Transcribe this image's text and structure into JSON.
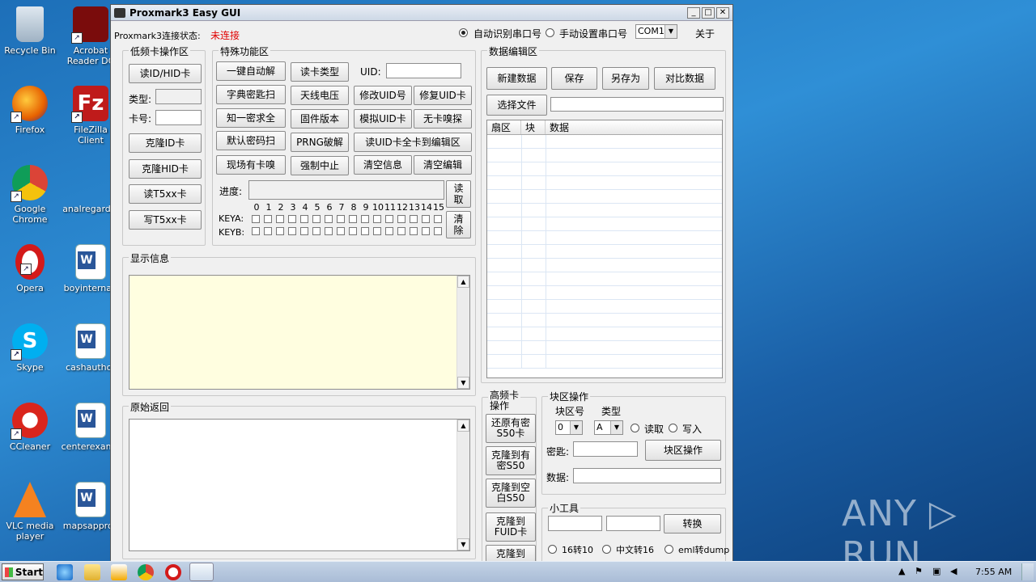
{
  "desktop": {
    "icons": [
      {
        "label": "Recycle Bin",
        "icon": "recycle-bin-icon"
      },
      {
        "label": "Acrobat Reader DC",
        "icon": "acrobat-icon"
      },
      {
        "label": "Firefox",
        "icon": "firefox-icon"
      },
      {
        "label": "FileZilla Client",
        "icon": "filezilla-icon"
      },
      {
        "label": "Google Chrome",
        "icon": "chrome-icon"
      },
      {
        "label": "analregardin",
        "icon": "file-icon"
      },
      {
        "label": "Opera",
        "icon": "opera-icon"
      },
      {
        "label": "boyinternati",
        "icon": "word-doc-icon"
      },
      {
        "label": "Skype",
        "icon": "skype-icon"
      },
      {
        "label": "cashauthor",
        "icon": "word-doc-icon"
      },
      {
        "label": "CCleaner",
        "icon": "ccleaner-icon"
      },
      {
        "label": "centerexamp",
        "icon": "word-doc-icon"
      },
      {
        "label": "VLC media player",
        "icon": "vlc-icon"
      },
      {
        "label": "mapsapprov",
        "icon": "word-doc-icon"
      }
    ],
    "watermark": "ANY ▷ RUN"
  },
  "window": {
    "title": "Proxmark3 Easy GUI",
    "controls": {
      "minimize": "_",
      "maximize": "□",
      "close": "✕"
    },
    "status_label": "Proxmark3连接状态:",
    "status_value": "未连接",
    "radio_auto": "自动识别串口号",
    "radio_manual": "手动设置串口号",
    "com_port": "COM1",
    "about": "关于",
    "low_freq": {
      "title": "低频卡操作区",
      "read_id_hid": "读ID/HID卡",
      "type_label": "类型:",
      "card_no_label": "卡号:",
      "clone_id": "克隆ID卡",
      "clone_hid": "克隆HID卡",
      "read_t5": "读T5xx卡",
      "write_t5": "写T5xx卡"
    },
    "special": {
      "title": "特殊功能区",
      "buttons": {
        "one_click": "一键自动解",
        "read_type": "读卡类型",
        "uid_label": "UID:",
        "dict_scan": "字典密匙扫",
        "antenna": "天线电压",
        "modify_uid": "修改UID号",
        "fix_uid": "修复UID卡",
        "know_one": "知一密求全",
        "firmware": "固件版本",
        "sim_uid": "模拟UID卡",
        "no_card": "无卡嗅探",
        "default_scan": "默认密码扫",
        "prng": "PRNG破解",
        "read_uid_full": "读UID卡全卡到编辑区",
        "sniff": "现场有卡嗅",
        "force_stop": "强制中止",
        "clear_info": "清空信息",
        "clear_edit": "清空编辑"
      },
      "progress_label": "进度:",
      "progress": 0,
      "read_btn": "读取",
      "clear_btn": "清除",
      "keya": "KEYA:",
      "keyb": "KEYB:",
      "sectors": [
        "0",
        "1",
        "2",
        "3",
        "4",
        "5",
        "6",
        "7",
        "8",
        "9",
        "10",
        "11",
        "12",
        "13",
        "14",
        "15"
      ]
    },
    "data_edit": {
      "title": "数据编辑区",
      "new": "新建数据",
      "save": "保存",
      "save_as": "另存为",
      "compare": "对比数据",
      "select_file": "选择文件",
      "columns": [
        "扇区",
        "块",
        "数据"
      ]
    },
    "display": {
      "title": "显示信息"
    },
    "raw": {
      "title": "原始返回"
    },
    "high_freq": {
      "title": "高频卡操作",
      "restore": "还原有密S50卡",
      "clone_encrypted": "克隆到有密S50",
      "clone_blank": "克隆到空白S50",
      "clone_fuid": "克隆到FUID卡",
      "clone_more": "克隆到"
    },
    "block_ops": {
      "title": "块区操作",
      "block_no_label": "块区号",
      "type_label": "类型",
      "block_no": "0",
      "key_type": "A",
      "read": "读取",
      "write": "写入",
      "key_label": "密匙:",
      "op_btn": "块区操作",
      "data_label": "数据:"
    },
    "tools": {
      "title": "小工具",
      "convert": "转换",
      "opt1": "16转10",
      "opt2": "中文转16",
      "opt3": "eml转dump"
    }
  },
  "taskbar": {
    "start": "Start",
    "time": "7:55 AM"
  }
}
